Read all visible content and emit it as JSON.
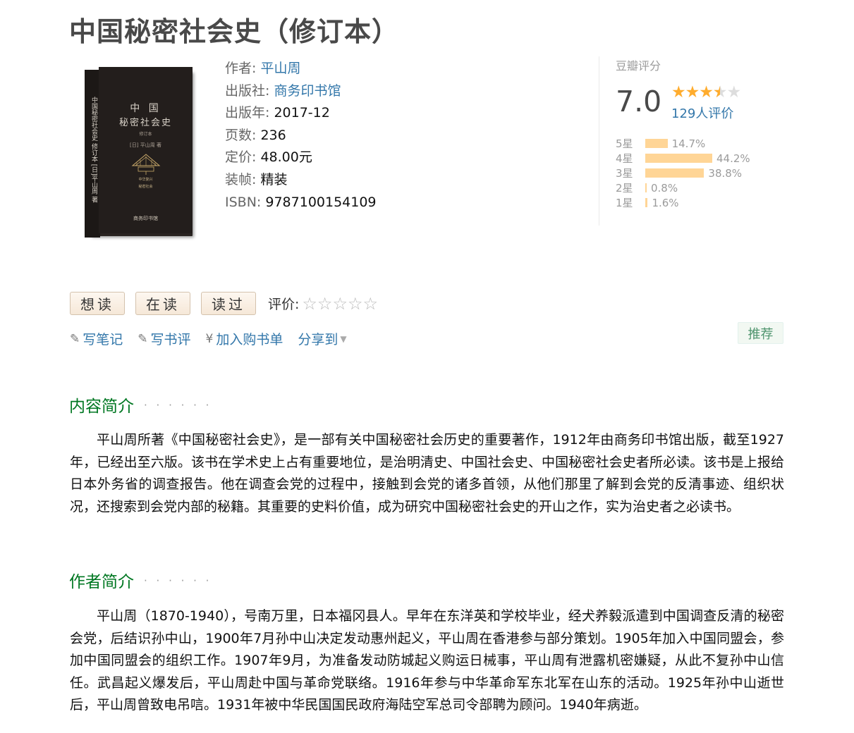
{
  "page": {
    "title": "中国秘密社会史（修订本）"
  },
  "cover": {
    "line1": "中 国",
    "line2": "秘密社会史",
    "line3": "修订本",
    "author": "[日] 平山周 著",
    "tag1": "中华复兴",
    "tag2": "秘密社会",
    "spine": "中国秘密社会史 修订本 [日]平山周 著",
    "publisher": "商务印书馆"
  },
  "info": {
    "author_label": "作者:",
    "author": "平山周",
    "publisher_label": "出版社:",
    "publisher": "商务印书馆",
    "pubyear_label": "出版年:",
    "pubyear": "2017-12",
    "pages_label": "页数:",
    "pages": "236",
    "price_label": "定价:",
    "price": "48.00元",
    "binding_label": "装帧:",
    "binding": "精装",
    "isbn_label": "ISBN:",
    "isbn": "9787100154109"
  },
  "rating": {
    "label": "豆瓣评分",
    "score": "7.0",
    "stars_value": 3.5,
    "count": "129人评价",
    "distribution": [
      {
        "label": "5星",
        "percent": "14.7%",
        "value": 14.7
      },
      {
        "label": "4星",
        "percent": "44.2%",
        "value": 44.2
      },
      {
        "label": "3星",
        "percent": "38.8%",
        "value": 38.8
      },
      {
        "label": "2星",
        "percent": "0.8%",
        "value": 0.8
      },
      {
        "label": "1星",
        "percent": "1.6%",
        "value": 1.6
      }
    ],
    "colors": {
      "star": "#ffac2d",
      "bar": "#ffd596"
    }
  },
  "actions": {
    "want": "想读",
    "reading": "在读",
    "read": "读过",
    "rate_label": "评价:",
    "empty_stars": "☆☆☆☆☆"
  },
  "subactions": {
    "note": "写笔记",
    "review": "写书评",
    "cart": "加入购书单",
    "share": "分享到",
    "note_icon": "pencil-icon",
    "review_icon": "pencil-icon",
    "cart_icon": "yen-icon",
    "share_icon": "chevron-down-icon"
  },
  "recommend": "推荐",
  "sections": {
    "content_title": "内容简介",
    "content_dots": "· · · · · ·",
    "content_text": "平山周所著《中国秘密社会史》，是一部有关中国秘密社会历史的重要著作，1912年由商务印书馆出版，截至1927年，已经出至六版。该书在学术史上占有重要地位，是治明清史、中国社会史、中国秘密社会史者所必读。该书是上报给日本外务省的调查报告。他在调查会党的过程中，接触到会党的诸多首领，从他们那里了解到会党的反清事迹、组织状况，还搜索到会党内部的秘籍。其重要的史料价值，成为研究中国秘密社会史的开山之作，实为治史者之必读书。",
    "author_title": "作者简介",
    "author_dots": "· · · · · ·",
    "author_text": "平山周（1870-1940），号南万里，日本福冈县人。早年在东洋英和学校毕业，经犬养毅派遣到中国调查反清的秘密会党，后结识孙中山，1900年7月孙中山决定发动惠州起义，平山周在香港参与部分策划。1905年加入中国同盟会，参加中国同盟会的组织工作。1907年9月，为准备发动防城起义购运日械事，平山周有泄露机密嫌疑，从此不复孙中山信任。武昌起义爆发后，平山周赴中国与革命党联络。1916年参与中华革命军东北军在山东的活动。1925年孙中山逝世后，平山周曾致电吊唁。1931年被中华民国国民政府海陆空军总司令部聘为顾问。1940年病逝。"
  }
}
